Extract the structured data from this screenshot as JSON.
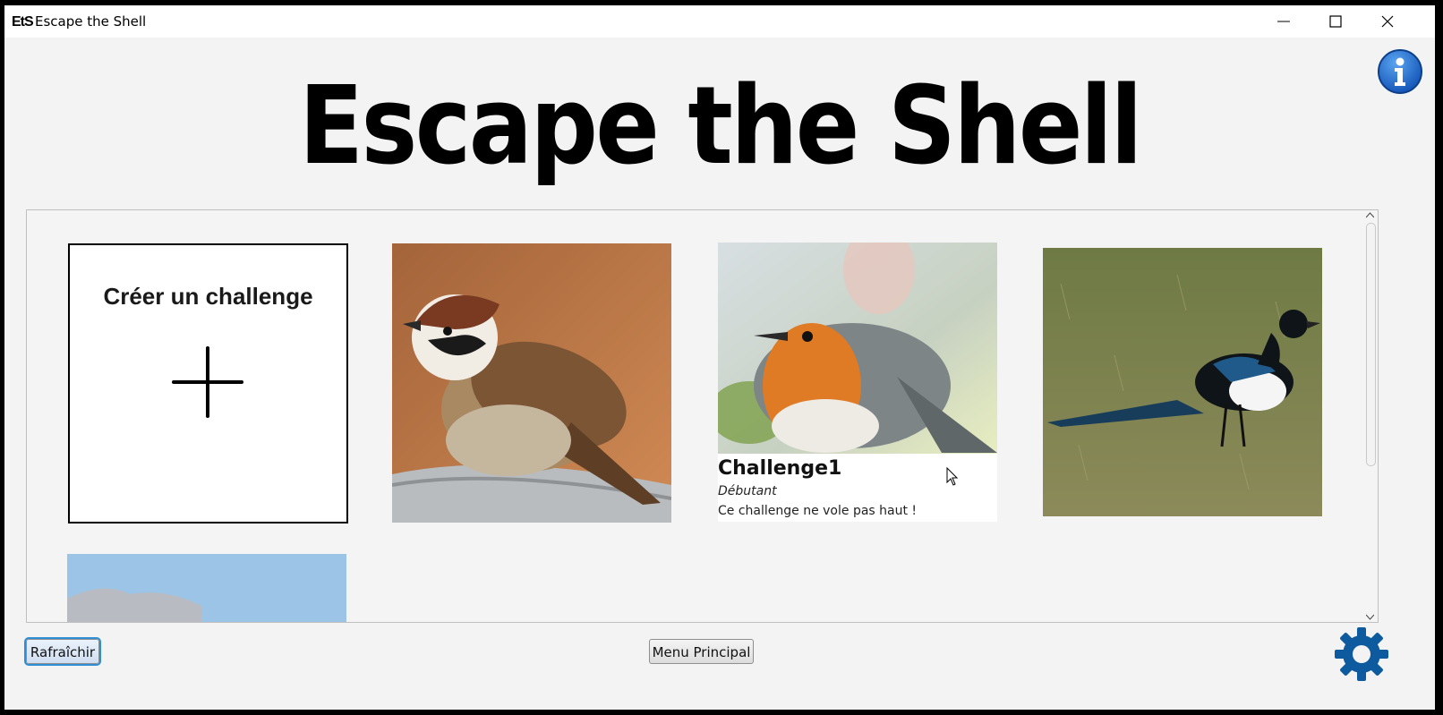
{
  "window": {
    "app_icon_text": "EtS",
    "title": "Escape the Shell",
    "minimize_icon": "minimize-icon",
    "maximize_icon": "maximize-icon",
    "close_icon": "close-icon"
  },
  "header": {
    "logo_text": "Escape the Shell",
    "info_icon": "info-icon"
  },
  "challenges": {
    "create_card": {
      "label": "Créer un challenge",
      "icon": "plus-icon"
    },
    "cards": [
      {
        "image": "sparrow-image"
      },
      {
        "image": "robin-image",
        "title": "Challenge1",
        "level": "Débutant",
        "description": "Ce challenge ne vole pas haut !"
      },
      {
        "image": "magpie-image"
      },
      {
        "image": "sky-image"
      }
    ]
  },
  "footer": {
    "refresh_label": "Rafraîchir",
    "main_menu_label": "Menu Principal",
    "settings_icon": "gear-icon"
  },
  "colors": {
    "window_bg": "#f3f3f3",
    "info_blue": "#1f6fd0",
    "settings_blue": "#0d5a9e",
    "focus_blue": "#2e8fd6"
  }
}
